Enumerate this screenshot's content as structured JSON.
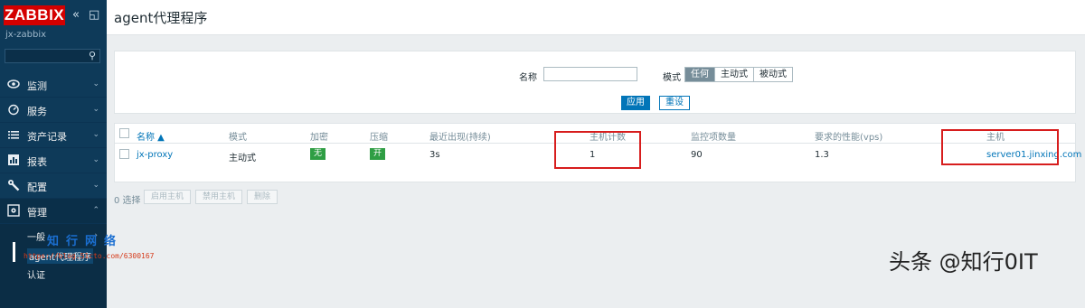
{
  "sidebar": {
    "brand": "ZABBIX",
    "collapse_icon": "«",
    "kiosk_icon": "◱",
    "server_name": "jx-zabbix",
    "search_icon": "⚲",
    "items": [
      {
        "label": "监测",
        "icon": "eye-icon"
      },
      {
        "label": "服务",
        "icon": "clock-icon"
      },
      {
        "label": "资产记录",
        "icon": "list-icon"
      },
      {
        "label": "报表",
        "icon": "bar-chart-icon"
      },
      {
        "label": "配置",
        "icon": "wrench-icon"
      },
      {
        "label": "管理",
        "icon": "gear-icon"
      }
    ],
    "chevron_down": "⌄",
    "chevron_up": "⌃",
    "admin_sub": {
      "general": "一般",
      "agent_proxies": "agent代理程序",
      "authentication": "认证",
      "chevron": "›"
    }
  },
  "header": {
    "title": "agent代理程序"
  },
  "filter": {
    "name_label": "名称",
    "mode_label": "模式",
    "mode_options": [
      "任何",
      "主动式",
      "被动式"
    ],
    "mode_selected": "任何",
    "apply_label": "应用",
    "reset_label": "重设"
  },
  "table": {
    "headers": {
      "name": "名称 ▲",
      "mode": "模式",
      "encryption": "加密",
      "compression": "压缩",
      "last_seen": "最近出现(持续)",
      "host_count": "主机计数",
      "item_count": "监控项数量",
      "required_performance": "要求的性能(vps)",
      "hosts": "主机"
    },
    "rows": [
      {
        "name": "jx-proxy",
        "mode": "主动式",
        "encryption": "无",
        "compression": "开",
        "last_seen": "3s",
        "host_count": "1",
        "item_count": "90",
        "required_performance": "1.3",
        "hosts": "server01.jinxing.com"
      }
    ]
  },
  "bulk": {
    "selected": "0 选择",
    "enable_hosts": "启用主机",
    "disable_hosts": "禁用主机",
    "delete": "删除"
  },
  "watermarks": {
    "cn": "知行网络",
    "url": "https://blog.51cto.com/6300167",
    "bottom": "头条 @知行0IT"
  },
  "colors": {
    "sidebar_bg": "#0e3a59",
    "brand_red": "#d40000",
    "link_blue": "#0275b8",
    "badge_green": "#2f9e44",
    "highlight_red": "#d71d1d"
  }
}
